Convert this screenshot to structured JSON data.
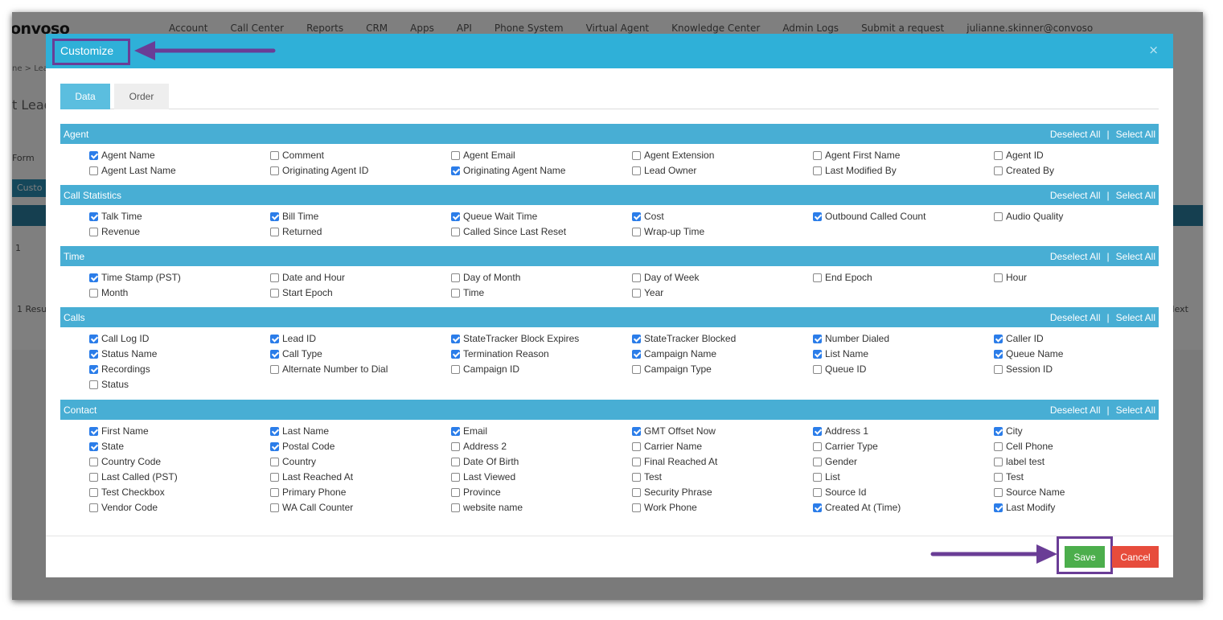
{
  "app": {
    "logo": "onvoso",
    "nav": [
      "Account",
      "Call Center",
      "Reports",
      "CRM",
      "Apps",
      "API",
      "Phone System",
      "Virtual Agent",
      "Knowledge Center",
      "Admin Logs",
      "Submit a request",
      "julianne.skinner@convoso"
    ],
    "background": {
      "breadcrumb": "ne > Lea",
      "title": "t Lead",
      "forms": "Form",
      "customize_btn": "Custo",
      "row_num": "1",
      "results": "1 Resu",
      "next": "Next"
    }
  },
  "modal": {
    "title": "Customize",
    "close": "×",
    "tabs": [
      {
        "label": "Data",
        "active": true
      },
      {
        "label": "Order",
        "active": false
      }
    ],
    "deselect_label": "Deselect All",
    "select_label": "Select All",
    "sections": [
      {
        "title": "Agent",
        "items": [
          {
            "label": "Agent Name",
            "checked": true
          },
          {
            "label": "Comment",
            "checked": false
          },
          {
            "label": "Agent Email",
            "checked": false
          },
          {
            "label": "Agent Extension",
            "checked": false
          },
          {
            "label": "Agent First Name",
            "checked": false
          },
          {
            "label": "Agent ID",
            "checked": false
          },
          {
            "label": "Agent Last Name",
            "checked": false
          },
          {
            "label": "Originating Agent ID",
            "checked": false
          },
          {
            "label": "Originating Agent Name",
            "checked": true
          },
          {
            "label": "Lead Owner",
            "checked": false
          },
          {
            "label": "Last Modified By",
            "checked": false
          },
          {
            "label": "Created By",
            "checked": false
          }
        ]
      },
      {
        "title": "Call Statistics",
        "items": [
          {
            "label": "Talk Time",
            "checked": true
          },
          {
            "label": "Bill Time",
            "checked": true
          },
          {
            "label": "Queue Wait Time",
            "checked": true
          },
          {
            "label": "Cost",
            "checked": true
          },
          {
            "label": "Outbound Called Count",
            "checked": true
          },
          {
            "label": "Audio Quality",
            "checked": false
          },
          {
            "label": "Revenue",
            "checked": false
          },
          {
            "label": "Returned",
            "checked": false
          },
          {
            "label": "Called Since Last Reset",
            "checked": false
          },
          {
            "label": "Wrap-up Time",
            "checked": false
          }
        ]
      },
      {
        "title": "Time",
        "items": [
          {
            "label": "Time Stamp (PST)",
            "checked": true
          },
          {
            "label": "Date and Hour",
            "checked": false
          },
          {
            "label": "Day of Month",
            "checked": false
          },
          {
            "label": "Day of Week",
            "checked": false
          },
          {
            "label": "End Epoch",
            "checked": false
          },
          {
            "label": "Hour",
            "checked": false
          },
          {
            "label": "Month",
            "checked": false
          },
          {
            "label": "Start Epoch",
            "checked": false
          },
          {
            "label": "Time",
            "checked": false
          },
          {
            "label": "Year",
            "checked": false
          }
        ]
      },
      {
        "title": "Calls",
        "items": [
          {
            "label": "Call Log ID",
            "checked": true
          },
          {
            "label": "Lead ID",
            "checked": true
          },
          {
            "label": "StateTracker Block Expires",
            "checked": true
          },
          {
            "label": "StateTracker Blocked",
            "checked": true
          },
          {
            "label": "Number Dialed",
            "checked": true
          },
          {
            "label": "Caller ID",
            "checked": true
          },
          {
            "label": "Status Name",
            "checked": true
          },
          {
            "label": "Call Type",
            "checked": true
          },
          {
            "label": "Termination Reason",
            "checked": true
          },
          {
            "label": "Campaign Name",
            "checked": true
          },
          {
            "label": "List Name",
            "checked": true
          },
          {
            "label": "Queue Name",
            "checked": true
          },
          {
            "label": "Recordings",
            "checked": true
          },
          {
            "label": "Alternate Number to Dial",
            "checked": false
          },
          {
            "label": "Campaign ID",
            "checked": false
          },
          {
            "label": "Campaign Type",
            "checked": false
          },
          {
            "label": "Queue ID",
            "checked": false
          },
          {
            "label": "Session ID",
            "checked": false
          },
          {
            "label": "Status",
            "checked": false
          }
        ]
      },
      {
        "title": "Contact",
        "items": [
          {
            "label": "First Name",
            "checked": true
          },
          {
            "label": "Last Name",
            "checked": true
          },
          {
            "label": "Email",
            "checked": true
          },
          {
            "label": "GMT Offset Now",
            "checked": true
          },
          {
            "label": "Address 1",
            "checked": true
          },
          {
            "label": "City",
            "checked": true
          },
          {
            "label": "State",
            "checked": true
          },
          {
            "label": "Postal Code",
            "checked": true
          },
          {
            "label": "Address 2",
            "checked": false
          },
          {
            "label": "Carrier Name",
            "checked": false
          },
          {
            "label": "Carrier Type",
            "checked": false
          },
          {
            "label": "Cell Phone",
            "checked": false
          },
          {
            "label": "Country Code",
            "checked": false
          },
          {
            "label": "Country",
            "checked": false
          },
          {
            "label": "Date Of Birth",
            "checked": false
          },
          {
            "label": "Final Reached At",
            "checked": false
          },
          {
            "label": "Gender",
            "checked": false
          },
          {
            "label": "label test",
            "checked": false
          },
          {
            "label": "Last Called (PST)",
            "checked": false
          },
          {
            "label": "Last Reached At",
            "checked": false
          },
          {
            "label": "Last Viewed",
            "checked": false
          },
          {
            "label": "Test",
            "checked": false
          },
          {
            "label": "List",
            "checked": false
          },
          {
            "label": "Test",
            "checked": false
          },
          {
            "label": "Test Checkbox",
            "checked": false
          },
          {
            "label": "Primary Phone",
            "checked": false
          },
          {
            "label": "Province",
            "checked": false
          },
          {
            "label": "Security Phrase",
            "checked": false
          },
          {
            "label": "Source Id",
            "checked": false
          },
          {
            "label": "Source Name",
            "checked": false
          },
          {
            "label": "Vendor Code",
            "checked": false
          },
          {
            "label": "WA Call Counter",
            "checked": false
          },
          {
            "label": "website name",
            "checked": false
          },
          {
            "label": "Work Phone",
            "checked": false
          },
          {
            "label": "Created At (Time)",
            "checked": true
          },
          {
            "label": "Last Modify",
            "checked": true
          }
        ]
      }
    ],
    "footer": {
      "save_label": "Save",
      "cancel_label": "Cancel"
    }
  },
  "colors": {
    "header": "#2fb0d8",
    "section": "#48aed4",
    "annotation": "#6a3d96",
    "save": "#4cae4c",
    "cancel": "#e74c3c"
  }
}
